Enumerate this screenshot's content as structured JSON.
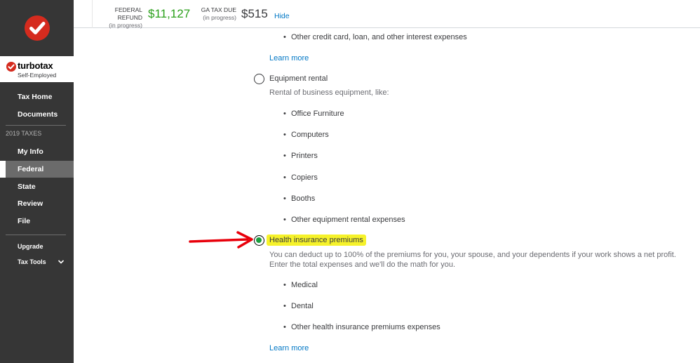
{
  "sidebar": {
    "brand_name": "turbotax",
    "brand_sub": "Self-Employed",
    "section_label": "2019 TAXES",
    "top_items": [
      "Tax Home",
      "Documents"
    ],
    "tax_items": [
      "My Info",
      "Federal",
      "State",
      "Review",
      "File"
    ],
    "active_item": "Federal",
    "bottom_items": [
      "Upgrade",
      "Tax Tools"
    ]
  },
  "header": {
    "federal_label": "FEDERAL REFUND",
    "federal_status": "(in progress)",
    "federal_amount": "$11,127",
    "state_label": "GA TAX DUE",
    "state_status": "(in progress)",
    "state_amount": "$515",
    "hide_label": "Hide"
  },
  "content": {
    "top_bullet": "Other credit card, loan, and other interest expenses",
    "learn_more_1": "Learn more",
    "equipment": {
      "title": "Equipment rental",
      "desc": "Rental of business equipment, like:",
      "items": [
        "Office Furniture",
        "Computers",
        "Printers",
        "Copiers",
        "Booths",
        "Other equipment rental expenses"
      ],
      "selected": false
    },
    "health": {
      "title": "Health insurance premiums",
      "desc_line1": "You can deduct up to 100% of the premiums for you, your spouse, and your dependents if your work shows a net profit.",
      "desc_line2": "Enter the total expenses and we'll do the math for you.",
      "items": [
        "Medical",
        "Dental",
        "Other health insurance premiums expenses"
      ],
      "selected": true
    },
    "learn_more_2": "Learn more"
  },
  "colors": {
    "sidebar_bg": "#363636",
    "active_bg": "#6b6b6b",
    "refund_green": "#2ca01c",
    "link_blue": "#0077c5",
    "highlight_yellow": "#f6f22a",
    "arrow_red": "#e8000b",
    "logo_red": "#d52b1e"
  },
  "icons": [
    "turbotax-checkmark-logo",
    "turbotax-brand-check",
    "chevron-down-icon",
    "red-arrow-annotation"
  ]
}
